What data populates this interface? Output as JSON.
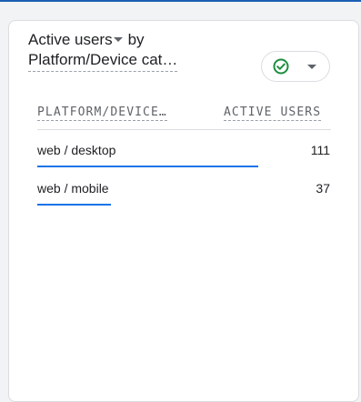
{
  "card": {
    "metric_label": "Active users",
    "by_label": "by",
    "dimension_label": "Platform/Device cat…",
    "status": {
      "icon": "check-circle-icon",
      "color": "#1e8e3e"
    }
  },
  "table": {
    "columns": [
      "PLATFORM/DEVICE…",
      "ACTIVE USERS"
    ],
    "rows": [
      {
        "label": "web / desktop",
        "value": "111",
        "share": 1.0
      },
      {
        "label": "web / mobile",
        "value": "37",
        "share": 0.333
      }
    ]
  },
  "colors": {
    "accent": "#1a73e8",
    "success": "#1e8e3e"
  }
}
